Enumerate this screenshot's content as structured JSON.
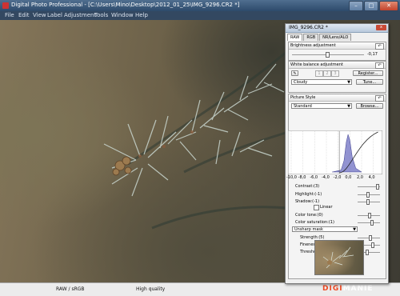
{
  "window": {
    "title": "Digital Photo Professional - [C:\\Users\\Mino\\Desktop\\2012_01_25\\IMG_9296.CR2 *]",
    "minimize": "–",
    "maximize": "□",
    "close": "✕"
  },
  "menu": [
    "File",
    "Edit",
    "View",
    "Label",
    "Adjustment",
    "Tools",
    "Window",
    "Help"
  ],
  "status": {
    "left": "RAW / sRGB",
    "right": "High quality"
  },
  "watermark": {
    "a": "DIGI",
    "b": "MANIE"
  },
  "panel": {
    "title": "IMG_9296.CR2 *",
    "close": "x",
    "tabs": [
      "RAW",
      "RGB",
      "NR/Lens/ALO"
    ],
    "brightness": {
      "label": "Brightness adjustment",
      "value": "-0,17",
      "level": -0.17
    },
    "wb": {
      "label": "White balance adjustment",
      "nums": [
        "1",
        "2",
        "3"
      ],
      "register": "Register...",
      "preset": "Cloudy",
      "tune": "Tune..."
    },
    "picture_style": {
      "label": "Picture Style",
      "style": "Standard",
      "browse": "Browse...",
      "ticks": [
        "-10,0",
        "-8,0",
        "-6,0",
        "-4,0",
        "-2,0",
        "0,0",
        "2,0",
        "4,0"
      ],
      "contrast": "Contrast:(3)",
      "highlight": "Highlight:(-1)",
      "shadow": "Shadow:(-1)",
      "linear": "Linear",
      "color_tone": "Color tone:(0)",
      "color_saturation": "Color saturation:(1)",
      "sharp_mode": "Unsharp mask",
      "strength": "Strength:(5)",
      "fineness": "Fineness:(7)",
      "threshold": "Threshold:(3)"
    }
  },
  "chart_data": {
    "type": "area",
    "x_ticks": [
      "-10,0",
      "-8,0",
      "-6,0",
      "-4,0",
      "-2,0",
      "0,0",
      "2,0",
      "4,0"
    ],
    "xlim": [
      -10,
      5
    ],
    "series": [
      {
        "values_x": [
          -3.0,
          -1.5,
          -1.0,
          -0.6,
          -0.3,
          0.0,
          0.4,
          1.0,
          2.0
        ],
        "values_y": [
          0,
          0.05,
          0.3,
          0.8,
          1.0,
          0.85,
          0.4,
          0.1,
          0
        ]
      }
    ]
  }
}
